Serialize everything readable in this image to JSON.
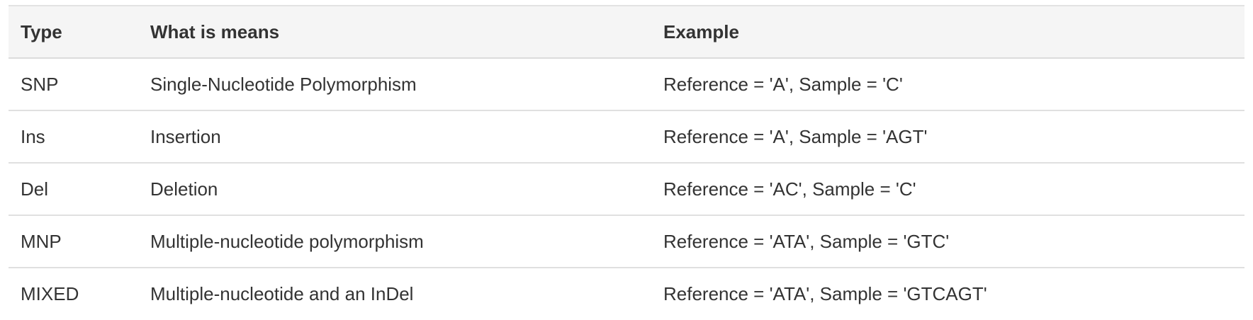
{
  "table": {
    "headers": [
      "Type",
      "What is means",
      "Example"
    ],
    "rows": [
      [
        "SNP",
        "Single-Nucleotide Polymorphism",
        "Reference = 'A', Sample = 'C'"
      ],
      [
        "Ins",
        "Insertion",
        "Reference = 'A', Sample = 'AGT'"
      ],
      [
        "Del",
        "Deletion",
        "Reference = 'AC', Sample = 'C'"
      ],
      [
        "MNP",
        "Multiple-nucleotide polymorphism",
        "Reference = 'ATA', Sample = 'GTC'"
      ],
      [
        "MIXED",
        "Multiple-nucleotide and an InDel",
        "Reference = 'ATA', Sample = 'GTCAGT'"
      ]
    ]
  }
}
